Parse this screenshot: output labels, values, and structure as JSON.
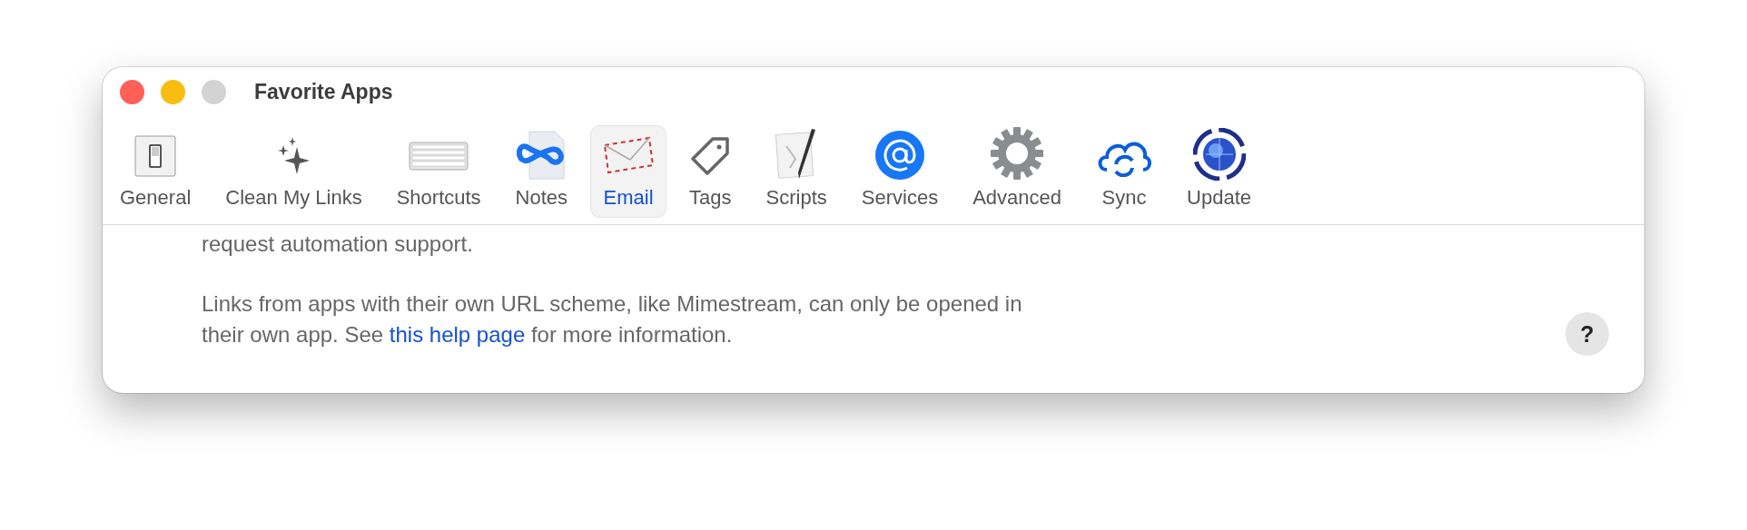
{
  "window": {
    "title": "Favorite Apps",
    "controls": [
      {
        "color": "#fe5f57"
      },
      {
        "color": "#f9bd12"
      },
      {
        "color": "#d3d3d3"
      }
    ]
  },
  "tabs": [
    {
      "label": "General",
      "kind": "switch",
      "selected": false
    },
    {
      "label": "Clean My Links",
      "kind": "sparkles",
      "selected": false
    },
    {
      "label": "Shortcuts",
      "kind": "keyboard",
      "selected": false
    },
    {
      "label": "Notes",
      "kind": "notes",
      "selected": false
    },
    {
      "label": "Email",
      "kind": "envelope",
      "selected": true
    },
    {
      "label": "Tags",
      "kind": "tag",
      "selected": false
    },
    {
      "label": "Scripts",
      "kind": "script",
      "selected": false
    },
    {
      "label": "Services",
      "kind": "at",
      "selected": false
    },
    {
      "label": "Advanced",
      "kind": "gear",
      "selected": false
    },
    {
      "label": "Sync",
      "kind": "cloud",
      "selected": false
    },
    {
      "label": "Update",
      "kind": "globe",
      "selected": false
    }
  ],
  "content": {
    "paragraphs": [
      {
        "text": "request automation support."
      },
      {
        "text": "Links from apps with their own URL scheme, like Mimestream, can only be opened in their own app. See ",
        "link": "this help page",
        "text_after": " for more information."
      }
    ]
  },
  "help_button": {
    "label": "?"
  }
}
